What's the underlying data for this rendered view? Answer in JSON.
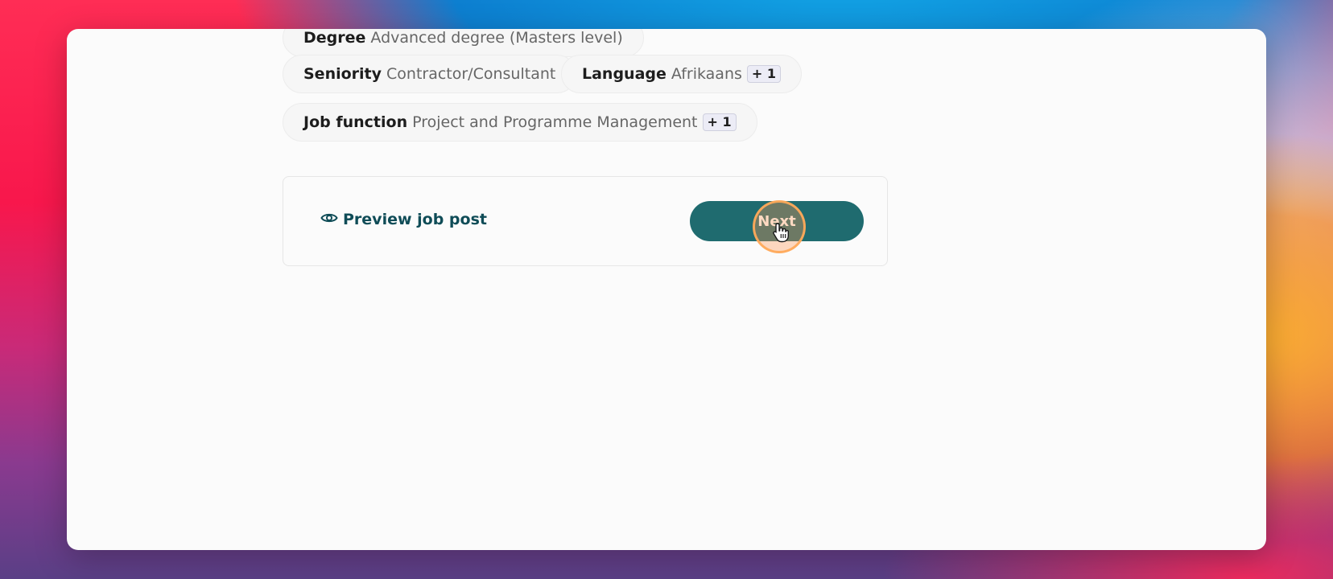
{
  "chips": [
    {
      "key": "Degree",
      "value": "Advanced degree (Masters level)",
      "more": ""
    },
    {
      "key": "Seniority",
      "value": "Contractor/Consultant",
      "more": ""
    },
    {
      "key": "Language",
      "value": "Afrikaans",
      "more": "+ 1"
    },
    {
      "key": "Job function",
      "value": "Project and Programme Management",
      "more": "+ 1"
    }
  ],
  "footer": {
    "preview_label": "Preview job post",
    "next_label": "Next"
  },
  "colors": {
    "accent": "#1f6b6f",
    "link": "#0f4c57"
  },
  "icons": {
    "preview": "eye-icon",
    "cursor": "hand-pointer-icon"
  }
}
